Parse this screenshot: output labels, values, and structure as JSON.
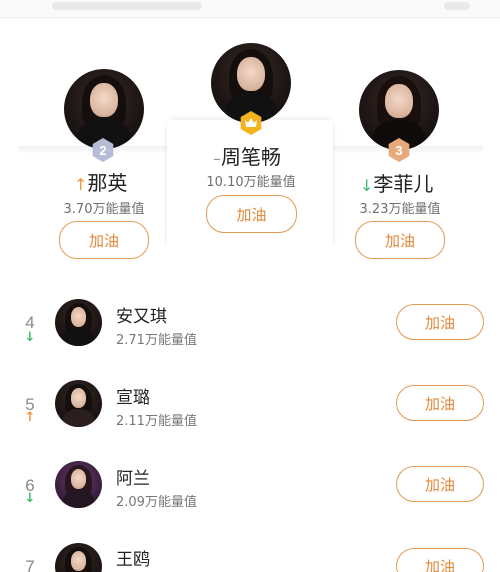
{
  "top3": [
    {
      "rank": "2",
      "trend": "up",
      "trend_glyph": "↑",
      "name": "那英",
      "energy": "3.70万能量值",
      "button": "加油",
      "badge_color": "#b6bbd6"
    },
    {
      "rank": "1",
      "trend": "same",
      "trend_glyph": "–",
      "name": "周笔畅",
      "energy": "10.10万能量值",
      "button": "加油",
      "badge_color": "#f3b41b",
      "badge_icon": "crown-icon"
    },
    {
      "rank": "3",
      "trend": "down",
      "trend_glyph": "↓",
      "name": "李菲儿",
      "energy": "3.23万能量值",
      "button": "加油",
      "badge_color": "#e8a97a"
    }
  ],
  "list": [
    {
      "rank": "4",
      "trend": "down",
      "trend_glyph": "↓",
      "name": "安又琪",
      "energy": "2.71万能量值",
      "button": "加油"
    },
    {
      "rank": "5",
      "trend": "up",
      "trend_glyph": "↑",
      "name": "宣璐",
      "energy": "2.11万能量值",
      "button": "加油"
    },
    {
      "rank": "6",
      "trend": "down",
      "trend_glyph": "↓",
      "name": "阿兰",
      "energy": "2.09万能量值",
      "button": "加油"
    },
    {
      "rank": "7",
      "trend": "",
      "trend_glyph": "",
      "name": "王鸥",
      "energy": "",
      "button": "加油"
    }
  ],
  "colors": {
    "accent": "#e08a3c",
    "up": "#f0963c",
    "down": "#3fbf6b"
  }
}
